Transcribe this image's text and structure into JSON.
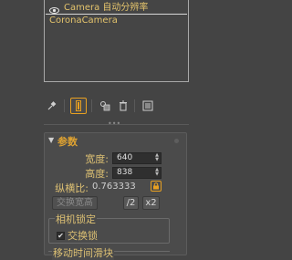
{
  "layer_list": {
    "rows": [
      {
        "label": "Camera 自动分辨率",
        "icon": "eye-icon"
      },
      {
        "label": "CoronaCamera"
      }
    ]
  },
  "toolbar": {
    "icons": [
      "pin-icon",
      "modifier-active-icon",
      "make-unique-icon",
      "delete-icon",
      "configure-sets-icon"
    ]
  },
  "panel": {
    "title": "参数",
    "width_label": "宽度:",
    "width_value": "640",
    "height_label": "高度:",
    "height_value": "838",
    "ratio_label": "纵横比:",
    "ratio_value": "0.763333",
    "swap_button": "交换宽高",
    "half_button": "/2",
    "double_button": "x2",
    "camera_lock_title": "相机锁定",
    "swap_lock_label": "交换锁",
    "swap_lock_checked": "✔",
    "slider_title": "移动时间滑块"
  },
  "colors": {
    "accent": "#e8a021",
    "label": "#ddc073",
    "background": "#444444"
  }
}
